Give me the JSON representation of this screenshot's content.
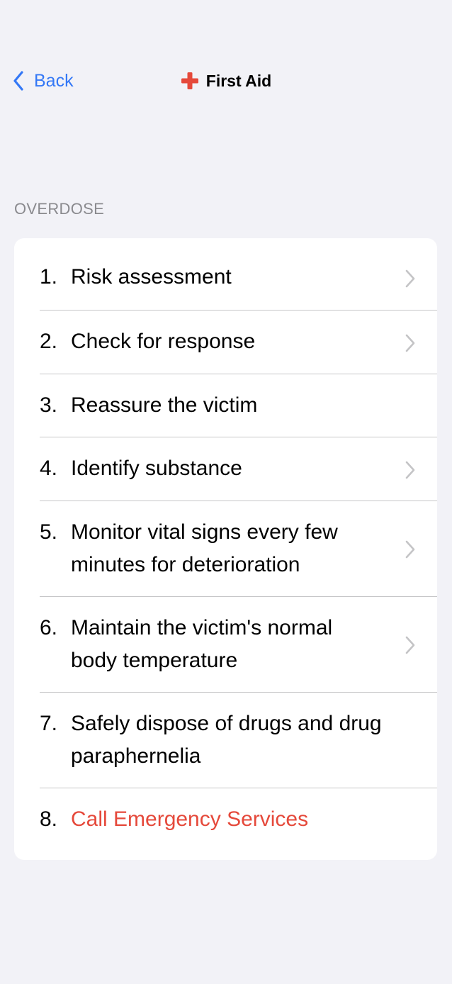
{
  "nav": {
    "back_label": "Back",
    "title": "First Aid"
  },
  "section": {
    "header": "OVERDOSE",
    "items": [
      {
        "num": "1.",
        "label": "Risk assessment",
        "chevron": true
      },
      {
        "num": "2.",
        "label": "Check for response",
        "chevron": true
      },
      {
        "num": "3.",
        "label": "Reassure the victim",
        "chevron": false
      },
      {
        "num": "4.",
        "label": "Identify substance",
        "chevron": true
      },
      {
        "num": "5.",
        "label": "Monitor vital signs every few minutes for deterioration",
        "chevron": true
      },
      {
        "num": "6.",
        "label": "Maintain the victim's normal body temperature",
        "chevron": true
      },
      {
        "num": "7.",
        "label": "Safely dispose of drugs and drug paraphernelia",
        "chevron": false
      },
      {
        "num": "8.",
        "label": "Call Emergency Services",
        "chevron": false
      }
    ]
  },
  "colors": {
    "accent": "#3478f6",
    "brand_red": "#e5493b",
    "background": "#f2f2f7",
    "chevron": "#c4c4c6"
  },
  "icons": {
    "back": "chevron-left-icon",
    "title": "medical-cross-icon",
    "row": "chevron-right-icon"
  }
}
